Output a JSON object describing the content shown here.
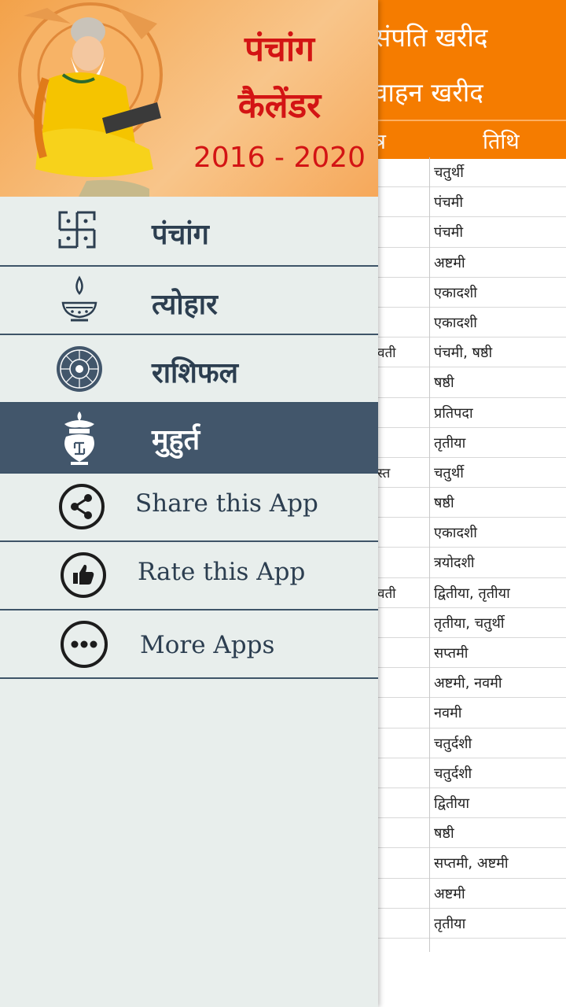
{
  "background": {
    "header_line1": "संपति खरीद",
    "header_line2": "वाहन खरीद",
    "column_left": "त्र",
    "column_right": "तिथि",
    "rows": [
      {
        "left": "",
        "right": "चतुर्थी"
      },
      {
        "left": "",
        "right": "पंचमी"
      },
      {
        "left": "",
        "right": "पंचमी"
      },
      {
        "left": "",
        "right": "अष्टमी"
      },
      {
        "left": "",
        "right": "एकादशी"
      },
      {
        "left": "",
        "right": "एकादशी"
      },
      {
        "left": "वती",
        "right": "पंचमी, षष्ठी"
      },
      {
        "left": "",
        "right": "षष्ठी"
      },
      {
        "left": "",
        "right": "प्रतिपदा"
      },
      {
        "left": "",
        "right": "तृतीया"
      },
      {
        "left": "स्त",
        "right": "चतुर्थी"
      },
      {
        "left": "",
        "right": "षष्ठी"
      },
      {
        "left": "",
        "right": "एकादशी"
      },
      {
        "left": "",
        "right": "त्रयोदशी"
      },
      {
        "left": "वती",
        "right": "द्वितीया, तृतीया"
      },
      {
        "left": "",
        "right": "तृतीया, चतुर्थी"
      },
      {
        "left": "",
        "right": "सप्तमी"
      },
      {
        "left": "",
        "right": "अष्टमी, नवमी"
      },
      {
        "left": "",
        "right": "नवमी"
      },
      {
        "left": "",
        "right": "चतुर्दशी"
      },
      {
        "left": "",
        "right": "चतुर्दशी"
      },
      {
        "left": "",
        "right": "द्वितीया"
      },
      {
        "left": "",
        "right": "षष्ठी"
      },
      {
        "left": "",
        "right": "सप्तमी, अष्टमी"
      },
      {
        "left": "",
        "right": "अष्टमी"
      },
      {
        "left": "",
        "right": "तृतीया"
      }
    ]
  },
  "drawer": {
    "header": {
      "line1": "पंचांग",
      "line2": "कैलेंडर",
      "line3": "2016 - 2020"
    },
    "menu": {
      "panchang": {
        "label": "पंचांग",
        "icon": "swastika-icon"
      },
      "tyohar": {
        "label": "त्योहार",
        "icon": "diya-lamp-icon"
      },
      "rashifal": {
        "label": "राशिफल",
        "icon": "zodiac-wheel-icon"
      },
      "muhurat": {
        "label": "मुहुर्त",
        "icon": "kalash-icon"
      },
      "share": {
        "label": "Share this App",
        "icon": "share-icon"
      },
      "rate": {
        "label": "Rate this App",
        "icon": "thumbs-up-icon"
      },
      "more": {
        "label": "More Apps",
        "icon": "more-dots-icon"
      }
    },
    "colors": {
      "active_bg": "#42566b",
      "drawer_bg": "#e8eeec",
      "accent_orange": "#f57c00",
      "title_red": "#d31414"
    }
  }
}
